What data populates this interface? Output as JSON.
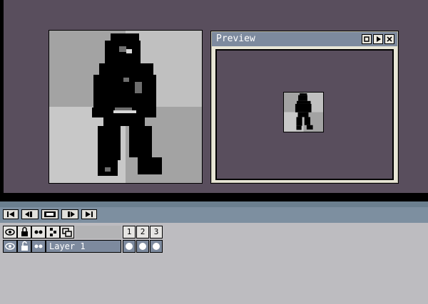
{
  "preview": {
    "title": "Preview",
    "controls": [
      "options-icon",
      "play-icon",
      "close-icon"
    ]
  },
  "transport": {
    "buttons": [
      "first-frame-icon",
      "previous-frame-icon",
      "play-animation-icon",
      "next-frame-icon",
      "last-frame-icon"
    ]
  },
  "layers": {
    "header_icons": [
      "eye-icon",
      "lock-icon",
      "onion-skin-icon",
      "link-icon",
      "layer-group-icon"
    ],
    "frames": [
      "1",
      "2",
      "3"
    ],
    "rows": [
      {
        "name": "Layer 1",
        "visible": true,
        "locked": false,
        "cels": 3
      }
    ]
  },
  "colors": {
    "workspace": "#594e5d",
    "titlebar": "#7d8a9e",
    "panel": "#bdbcc0",
    "sprite_dark": "#000000",
    "bg_gray_dark": "#6e6e6e",
    "bg_gray_light": "#b0b0b0"
  }
}
